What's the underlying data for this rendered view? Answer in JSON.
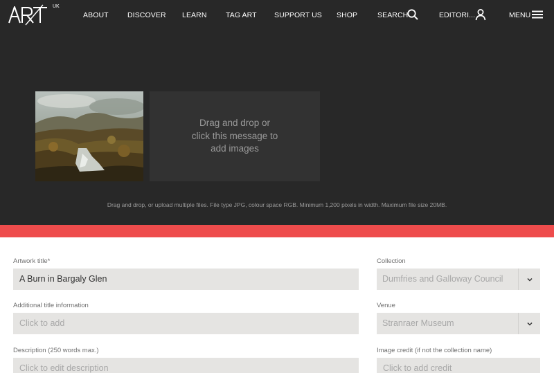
{
  "nav": {
    "logo_text": "ART",
    "logo_sub": "UK",
    "items": [
      "ABOUT",
      "DISCOVER",
      "LEARN",
      "TAG ART",
      "SUPPORT US",
      "SHOP"
    ],
    "search_label": "SEARCH",
    "account_label": "EDITORI...",
    "menu_label": "MENU"
  },
  "upload": {
    "dropzone_text": "Drag and drop or click this message to add images",
    "hint": "Drag and drop, or upload multiple files. File type JPG, colour space RGB. Minimum 1,200 pixels in width. Maximum file size 20MB."
  },
  "form": {
    "artwork_title": {
      "label": "Artwork title*",
      "value": "A Burn in Bargaly Glen"
    },
    "additional_title": {
      "label": "Additional title information",
      "placeholder": "Click to add"
    },
    "description": {
      "label": "Description (250 words max.)",
      "placeholder": "Click to edit description"
    },
    "collection": {
      "label": "Collection",
      "value": "Dumfries and Galloway Council"
    },
    "venue": {
      "label": "Venue",
      "value": "Stranraer Museum"
    },
    "image_credit": {
      "label": "Image credit (if not the collection name)",
      "placeholder": "Click to add credit"
    }
  },
  "colors": {
    "header_bg": "#282828",
    "accent_red": "#ee4c4c",
    "field_bg": "#e5e4e2"
  }
}
